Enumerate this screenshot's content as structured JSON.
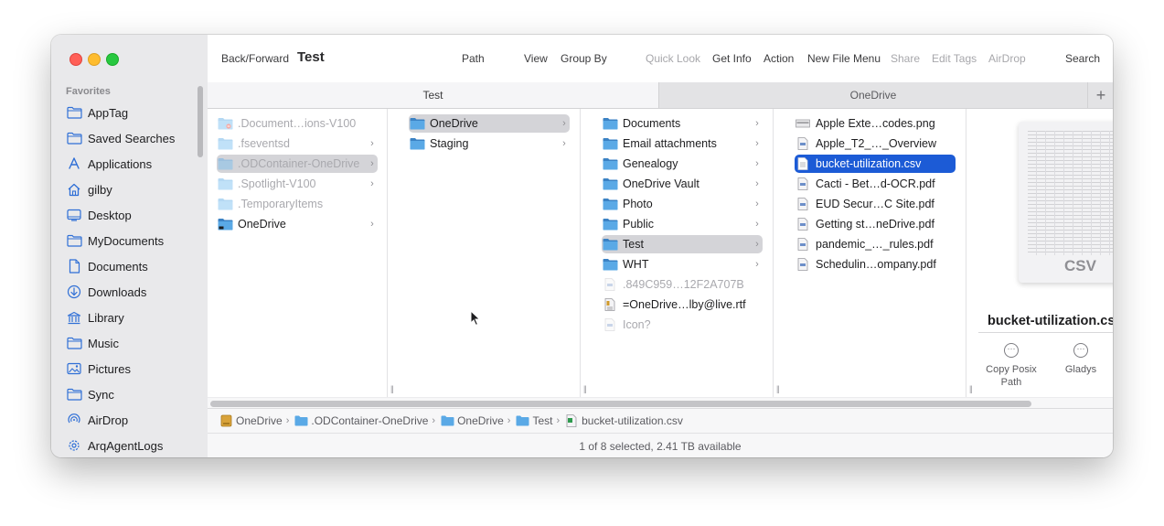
{
  "toolbar": {
    "back_forward": "Back/Forward",
    "title": "Test",
    "path": "Path",
    "view": "View",
    "group_by": "Group By",
    "quick_look": "Quick Look",
    "get_info": "Get Info",
    "action": "Action",
    "new_file_menu": "New File Menu",
    "share": "Share",
    "edit_tags": "Edit Tags",
    "airdrop": "AirDrop",
    "search": "Search"
  },
  "sidebar": {
    "header": "Favorites",
    "items": [
      {
        "label": "AppTag",
        "icon": "folder-icon"
      },
      {
        "label": "Saved Searches",
        "icon": "folder-icon"
      },
      {
        "label": "Applications",
        "icon": "applications-icon"
      },
      {
        "label": "gilby",
        "icon": "home-icon"
      },
      {
        "label": "Desktop",
        "icon": "desktop-icon"
      },
      {
        "label": "MyDocuments",
        "icon": "folder-icon"
      },
      {
        "label": "Documents",
        "icon": "document-icon"
      },
      {
        "label": "Downloads",
        "icon": "downloads-icon"
      },
      {
        "label": "Library",
        "icon": "library-icon"
      },
      {
        "label": "Music",
        "icon": "folder-icon"
      },
      {
        "label": "Pictures",
        "icon": "pictures-icon"
      },
      {
        "label": "Sync",
        "icon": "folder-icon"
      },
      {
        "label": "AirDrop",
        "icon": "airdrop-icon"
      },
      {
        "label": "ArqAgentLogs",
        "icon": "gear-icon"
      }
    ]
  },
  "tabs": {
    "active": "Test",
    "other": "OneDrive",
    "add": "+"
  },
  "columns": {
    "col1": [
      {
        "name": ".Document…ions-V100",
        "hidden": true,
        "chevron": false
      },
      {
        "name": ".fseventsd",
        "hidden": true,
        "chevron": true
      },
      {
        "name": ".ODContainer-OneDrive",
        "hidden": true,
        "chevron": true
      },
      {
        "name": ".Spotlight-V100",
        "hidden": true,
        "chevron": true
      },
      {
        "name": ".TemporaryItems",
        "hidden": true,
        "chevron": false
      },
      {
        "name": "OneDrive",
        "hidden": false,
        "chevron": true
      }
    ],
    "col2": [
      {
        "name": "OneDrive"
      },
      {
        "name": "Staging"
      }
    ],
    "col3": [
      {
        "name": "Documents",
        "type": "folder"
      },
      {
        "name": "Email attachments",
        "type": "folder"
      },
      {
        "name": "Genealogy",
        "type": "folder"
      },
      {
        "name": "OneDrive Vault",
        "type": "folder"
      },
      {
        "name": "Photo",
        "type": "folder"
      },
      {
        "name": "Public",
        "type": "folder"
      },
      {
        "name": "Test",
        "type": "folder"
      },
      {
        "name": "WHT",
        "type": "folder"
      },
      {
        "name": ".849C959…12F2A707B",
        "type": "hidden-file"
      },
      {
        "name": "=OneDrive…lby@live.rtf",
        "type": "rtf"
      },
      {
        "name": "Icon?",
        "type": "hidden-file"
      }
    ],
    "col4": [
      {
        "name": "Apple Exte…codes.png",
        "type": "png"
      },
      {
        "name": "Apple_T2_…_Overview",
        "type": "doc"
      },
      {
        "name": "bucket-utilization.csv",
        "type": "csv"
      },
      {
        "name": "Cacti - Bet…d-OCR.pdf",
        "type": "doc"
      },
      {
        "name": "EUD Secur…C Site.pdf",
        "type": "doc"
      },
      {
        "name": "Getting st…neDrive.pdf",
        "type": "doc"
      },
      {
        "name": "pandemic_…_rules.pdf",
        "type": "doc"
      },
      {
        "name": "Schedulin…ompany.pdf",
        "type": "doc"
      }
    ]
  },
  "preview": {
    "thumb_label": "CSV",
    "file_name": "bucket-utilization.csv",
    "actions": [
      {
        "label": "Copy Posix Path"
      },
      {
        "label": "Gladys"
      }
    ]
  },
  "pathbar": [
    {
      "label": "OneDrive",
      "icon": "drive-icon"
    },
    {
      "label": ".ODContainer-OneDrive",
      "icon": "folder-icon"
    },
    {
      "label": "OneDrive",
      "icon": "folder-icon"
    },
    {
      "label": "Test",
      "icon": "folder-icon"
    },
    {
      "label": "bucket-utilization.csv",
      "icon": "csv-icon"
    }
  ],
  "status": "1 of 8 selected, 2.41 TB available",
  "colors": {
    "selection_blue": "#1c5bd6",
    "folder_blue": "#5aa9e6",
    "sidebar_icon": "#2f6fd6"
  }
}
